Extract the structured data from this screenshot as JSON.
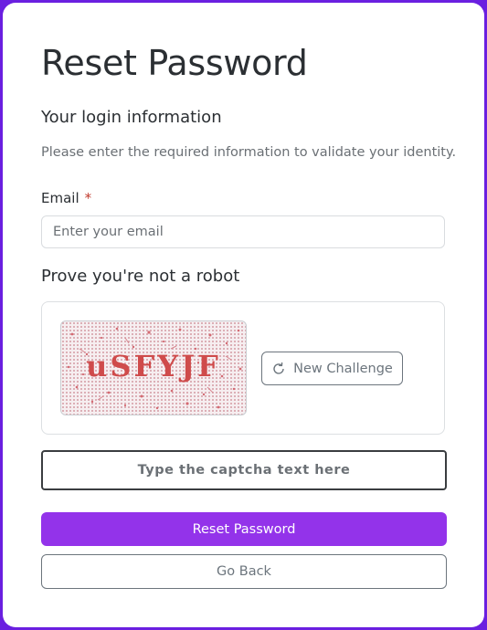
{
  "page": {
    "title": "Reset Password"
  },
  "login_section": {
    "heading": "Your login information",
    "description": "Please enter the required information to validate your identity."
  },
  "email": {
    "label": "Email",
    "required_marker": "*",
    "placeholder": "Enter your email",
    "value": ""
  },
  "captcha": {
    "heading": "Prove you're not a robot",
    "challenge_text": "uSFYJF",
    "new_challenge_label": "New Challenge",
    "new_challenge_icon": "refresh-icon",
    "input_placeholder": "Type the captcha text here",
    "input_value": ""
  },
  "actions": {
    "reset_label": "Reset Password",
    "back_label": "Go Back"
  },
  "colors": {
    "page_background": "#6a1fe0",
    "card_background": "#ffffff",
    "primary_button": "#9333ea",
    "secondary_outline": "#6c757d",
    "required_marker": "#c0392b",
    "captcha_text": "#cf4b4b"
  }
}
